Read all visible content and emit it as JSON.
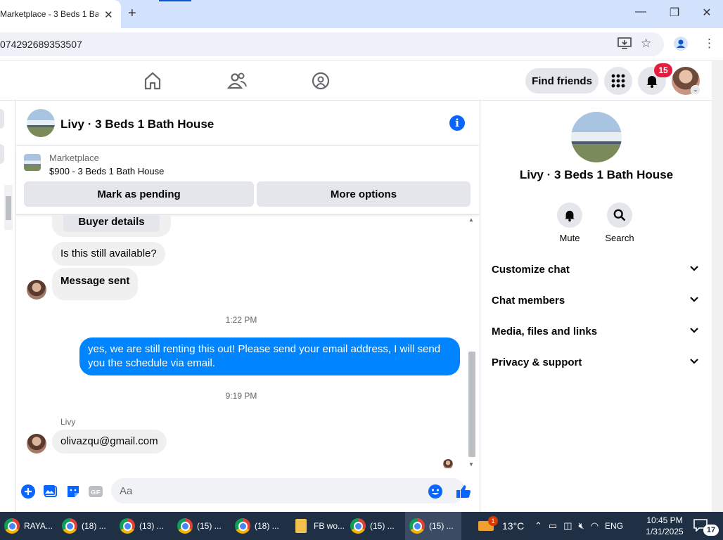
{
  "browser": {
    "tab_title": "Marketplace - 3 Beds 1 Bat",
    "url": "074292689353507"
  },
  "nav": {
    "find_friends": "Find friends",
    "notification_count": "15"
  },
  "chat": {
    "title": "Livy · 3 Beds 1 Bath House",
    "marketplace_label": "Marketplace",
    "listing": "$900 - 3 Beds 1 Bath House",
    "mark_pending": "Mark as pending",
    "more_options": "More options",
    "buyer_details": "Buyer details",
    "messages": [
      {
        "text": "Is this still available?"
      },
      {
        "text": "Message sent"
      },
      {
        "timestamp": "1:22 PM"
      },
      {
        "text": "yes, we are still renting this out! Please send your email address, I will send you the schedule via email."
      },
      {
        "timestamp": "9:19 PM"
      },
      {
        "sender": "Livy",
        "text": "olivazqu@gmail.com"
      }
    ],
    "composer_placeholder": "Aa"
  },
  "info": {
    "name": "Livy · 3 Beds 1 Bath House",
    "actions": [
      {
        "label": "Mute"
      },
      {
        "label": "Search"
      }
    ],
    "sections": [
      {
        "label": "Customize chat"
      },
      {
        "label": "Chat members"
      },
      {
        "label": "Media, files and links"
      },
      {
        "label": "Privacy & support"
      }
    ]
  },
  "taskbar": {
    "items": [
      {
        "label": "RAYA..."
      },
      {
        "label": "(18) ..."
      },
      {
        "label": "(13) ..."
      },
      {
        "label": "(15) ..."
      },
      {
        "label": "(18) ..."
      },
      {
        "label": "FB wo..."
      },
      {
        "label": "(15) ..."
      },
      {
        "label": "(15) ..."
      }
    ],
    "weather_badge": "1",
    "temperature": "13°C",
    "language": "ENG",
    "time": "10:45 PM",
    "date": "1/31/2025",
    "notification_count": "17"
  },
  "colors": {
    "accent": "#0866ff",
    "outgoing_bubble": "#0084ff",
    "badge": "#e41e3f"
  }
}
